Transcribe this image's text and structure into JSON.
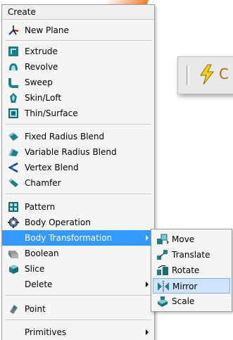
{
  "menu": {
    "title": "Create",
    "items": [
      {
        "label": "New Plane",
        "icon": "new-plane-icon"
      },
      {
        "label": "Extrude",
        "icon": "extrude-icon"
      },
      {
        "label": "Revolve",
        "icon": "revolve-icon"
      },
      {
        "label": "Sweep",
        "icon": "sweep-icon"
      },
      {
        "label": "Skin/Loft",
        "icon": "skin-loft-icon"
      },
      {
        "label": "Thin/Surface",
        "icon": "thin-surface-icon"
      },
      {
        "label": "Fixed Radius Blend",
        "icon": "fixed-radius-blend-icon"
      },
      {
        "label": "Variable Radius Blend",
        "icon": "variable-radius-blend-icon"
      },
      {
        "label": "Vertex Blend",
        "icon": "vertex-blend-icon"
      },
      {
        "label": "Chamfer",
        "icon": "chamfer-icon"
      },
      {
        "label": "Pattern",
        "icon": "pattern-icon"
      },
      {
        "label": "Body Operation",
        "icon": "body-operation-icon"
      },
      {
        "label": "Body Transformation",
        "icon": "body-transformation-icon",
        "has_submenu": true,
        "highlighted": true
      },
      {
        "label": "Boolean",
        "icon": "boolean-icon"
      },
      {
        "label": "Slice",
        "icon": "slice-icon"
      },
      {
        "label": "Delete",
        "has_submenu": true
      },
      {
        "label": "Point",
        "icon": "point-icon"
      },
      {
        "label": "Primitives",
        "has_submenu": true
      }
    ]
  },
  "submenu": {
    "items": [
      {
        "label": "Move",
        "icon": "move-icon"
      },
      {
        "label": "Translate",
        "icon": "translate-icon"
      },
      {
        "label": "Rotate",
        "icon": "rotate-icon"
      },
      {
        "label": "Mirror",
        "icon": "mirror-icon",
        "highlighted": true
      },
      {
        "label": "Scale",
        "icon": "scale-icon"
      }
    ]
  },
  "colors": {
    "highlight": "#3399ff",
    "submenu_highlight": "#cfe3ff",
    "icon_teal": "#1f7f86",
    "icon_dark_teal": "#1b6a70"
  },
  "background": {
    "toolbar_clipped_text": "C"
  }
}
